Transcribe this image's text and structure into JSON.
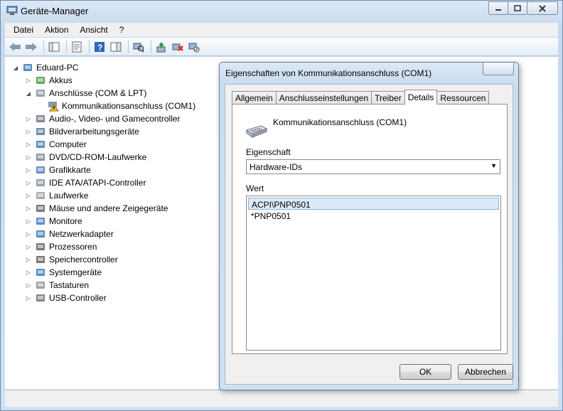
{
  "window": {
    "title": "Geräte-Manager"
  },
  "menu": [
    "Datei",
    "Aktion",
    "Ansicht",
    "?"
  ],
  "tree": {
    "root": "Eduard-PC",
    "items": [
      {
        "label": "Akkus"
      },
      {
        "label": "Anschlüsse (COM & LPT)"
      },
      {
        "label": "Kommunikationsanschluss (COM1)"
      },
      {
        "label": "Audio-, Video- und Gamecontroller"
      },
      {
        "label": "Bildverarbeitungsgeräte"
      },
      {
        "label": "Computer"
      },
      {
        "label": "DVD/CD-ROM-Laufwerke"
      },
      {
        "label": "Grafikkarte"
      },
      {
        "label": "IDE ATA/ATAPI-Controller"
      },
      {
        "label": "Laufwerke"
      },
      {
        "label": "Mäuse und andere Zeigegeräte"
      },
      {
        "label": "Monitore"
      },
      {
        "label": "Netzwerkadapter"
      },
      {
        "label": "Prozessoren"
      },
      {
        "label": "Speichercontroller"
      },
      {
        "label": "Systemgeräte"
      },
      {
        "label": "Tastaturen"
      },
      {
        "label": "USB-Controller"
      }
    ]
  },
  "dialog": {
    "title": "Eigenschaften von Kommunikationsanschluss (COM1)",
    "tabs": [
      "Allgemein",
      "Anschlusseinstellungen",
      "Treiber",
      "Details",
      "Ressourcen"
    ],
    "active_tab": "Details",
    "device_name": "Kommunikationsanschluss (COM1)",
    "property_label": "Eigenschaft",
    "property_value": "Hardware-IDs",
    "value_label": "Wert",
    "values": [
      "ACPI\\PNP0501",
      "*PNP0501"
    ],
    "ok": "OK",
    "cancel": "Abbrechen"
  }
}
